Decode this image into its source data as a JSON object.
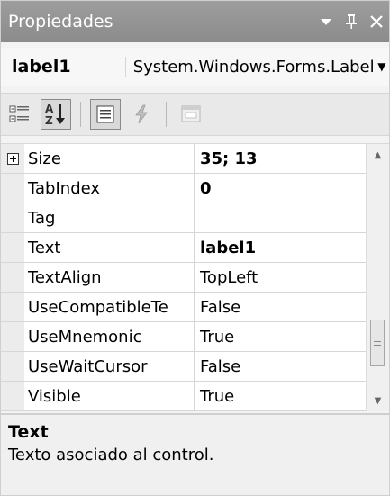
{
  "window": {
    "title": "Propiedades",
    "colors": {
      "titlebar": "#8f8f8f",
      "title_text": "#ffffff"
    }
  },
  "object_selector": {
    "name": "label1",
    "type": "System.Windows.Forms.Label"
  },
  "toolbar": {
    "buttons": [
      {
        "icon": "categorized-icon",
        "active": false
      },
      {
        "icon": "alphabetical-icon",
        "active": true
      },
      {
        "icon": "properties-icon",
        "active": false
      },
      {
        "icon": "events-icon",
        "active": false
      },
      {
        "icon": "property-pages-icon",
        "active": false
      }
    ]
  },
  "grid": {
    "rows": [
      {
        "name": "Size",
        "value": "35; 13",
        "bold": true,
        "expandable": true
      },
      {
        "name": "TabIndex",
        "value": "0",
        "bold": true,
        "expandable": false
      },
      {
        "name": "Tag",
        "value": "",
        "bold": false,
        "expandable": false
      },
      {
        "name": "Text",
        "value": "label1",
        "bold": true,
        "expandable": false
      },
      {
        "name": "TextAlign",
        "value": "TopLeft",
        "bold": false,
        "expandable": false
      },
      {
        "name": "UseCompatibleTe",
        "value": "False",
        "bold": false,
        "expandable": false
      },
      {
        "name": "UseMnemonic",
        "value": "True",
        "bold": false,
        "expandable": false
      },
      {
        "name": "UseWaitCursor",
        "value": "False",
        "bold": false,
        "expandable": false
      },
      {
        "name": "Visible",
        "value": "True",
        "bold": false,
        "expandable": false
      }
    ]
  },
  "help": {
    "title": "Text",
    "description": "Texto asociado al control."
  }
}
